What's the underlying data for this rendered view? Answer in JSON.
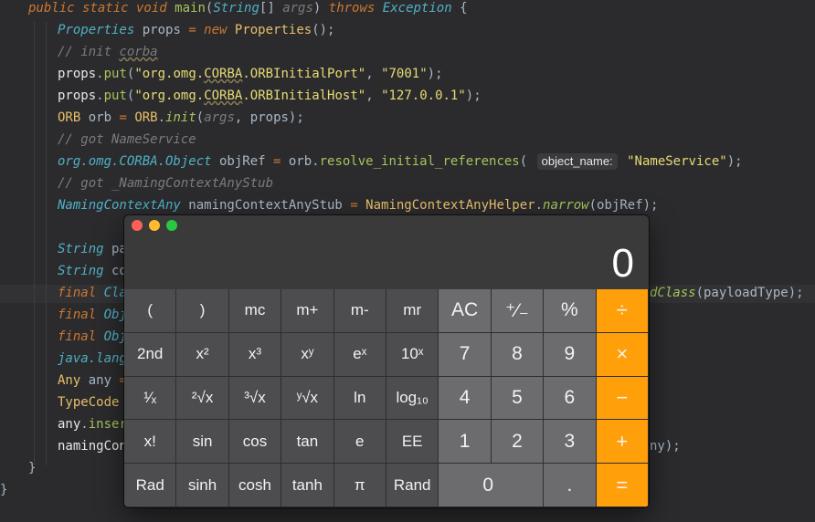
{
  "code": {
    "lines": [
      {
        "tokens": [
          [
            "kw",
            "public static void "
          ],
          [
            "fn",
            "main"
          ],
          [
            "p",
            "("
          ],
          [
            "type",
            "String"
          ],
          [
            "p",
            "[] "
          ],
          [
            "cm",
            "args"
          ],
          [
            "p",
            ") "
          ],
          [
            "kw",
            "throws "
          ],
          [
            "type",
            "Exception"
          ],
          [
            "p",
            " {"
          ]
        ]
      },
      {
        "tokens": [
          [
            "type",
            "Properties"
          ],
          [
            "p",
            " props "
          ],
          [
            "kw",
            "= new "
          ],
          [
            "typ2",
            "Properties"
          ],
          [
            "p",
            "();"
          ]
        ]
      },
      {
        "tokens": [
          [
            "cm",
            "// init "
          ],
          [
            "cmsq",
            "corba"
          ]
        ]
      },
      {
        "tokens": [
          [
            "var",
            "props"
          ],
          [
            "p",
            "."
          ],
          [
            "fn",
            "put"
          ],
          [
            "p",
            "("
          ],
          [
            "str",
            "\"org.omg."
          ],
          [
            "strsq",
            "CORBA"
          ],
          [
            "str",
            ".ORBInitialPort\""
          ],
          [
            "p",
            ", "
          ],
          [
            "str",
            "\"7001\""
          ],
          [
            "p",
            ");"
          ]
        ]
      },
      {
        "tokens": [
          [
            "var",
            "props"
          ],
          [
            "p",
            "."
          ],
          [
            "fn",
            "put"
          ],
          [
            "p",
            "("
          ],
          [
            "str",
            "\"org.omg."
          ],
          [
            "strsq",
            "CORBA"
          ],
          [
            "str",
            ".ORBInitialHost\""
          ],
          [
            "p",
            ", "
          ],
          [
            "str",
            "\"127.0.0.1\""
          ],
          [
            "p",
            ");"
          ]
        ]
      },
      {
        "tokens": [
          [
            "typ2",
            "ORB"
          ],
          [
            "p",
            " orb "
          ],
          [
            "kw",
            "= "
          ],
          [
            "typ2",
            "ORB"
          ],
          [
            "p",
            "."
          ],
          [
            "fni",
            "init"
          ],
          [
            "p",
            "("
          ],
          [
            "cm",
            "args"
          ],
          [
            "p",
            ", props);"
          ]
        ]
      },
      {
        "tokens": [
          [
            "cm",
            "// got NameService"
          ]
        ]
      },
      {
        "tokens": [
          [
            "type",
            "org.omg.CORBA.Object"
          ],
          [
            "p",
            " objRef "
          ],
          [
            "kw",
            "= "
          ],
          [
            "p",
            "orb."
          ],
          [
            "fn",
            "resolve_initial_references"
          ],
          [
            "p",
            "( "
          ],
          [
            "hint",
            "object_name:"
          ],
          [
            "str",
            " \"NameService\""
          ],
          [
            "p",
            ");"
          ]
        ]
      },
      {
        "tokens": [
          [
            "cm",
            "// got _NamingContextAnyStub"
          ]
        ]
      },
      {
        "tokens": [
          [
            "type",
            "NamingContextAny"
          ],
          [
            "p",
            " namingContextAnyStub "
          ],
          [
            "kw",
            "= "
          ],
          [
            "typ2",
            "NamingContextAnyHelper"
          ],
          [
            "p",
            "."
          ],
          [
            "fni",
            "narrow"
          ],
          [
            "p",
            "(objRef);"
          ]
        ]
      },
      {
        "tokens": []
      },
      {
        "tokens": [
          [
            "type",
            "String"
          ],
          [
            "p",
            " pa"
          ]
        ]
      },
      {
        "tokens": [
          [
            "type",
            "String"
          ],
          [
            "p",
            " co"
          ]
        ]
      },
      {
        "tokens": [
          [
            "kw",
            "final "
          ],
          [
            "type",
            "Cla"
          ]
        ]
      },
      {
        "tokens": [
          [
            "kw",
            "final "
          ],
          [
            "type",
            "Obj"
          ]
        ]
      },
      {
        "tokens": [
          [
            "kw",
            "final "
          ],
          [
            "type",
            "Obj"
          ]
        ]
      },
      {
        "tokens": [
          [
            "type",
            "java.lang"
          ]
        ]
      },
      {
        "tokens": [
          [
            "typ2",
            "Any"
          ],
          [
            "p",
            " any "
          ],
          [
            "kw",
            "="
          ]
        ]
      },
      {
        "tokens": [
          [
            "typ2",
            "TypeCode"
          ]
        ]
      },
      {
        "tokens": [
          [
            "var",
            "any"
          ],
          [
            "p",
            "."
          ],
          [
            "fn",
            "inser"
          ]
        ]
      },
      {
        "tokens": [
          [
            "var",
            "namingCon"
          ]
        ]
      },
      {
        "tokens": [
          [
            "p",
            "}"
          ]
        ]
      },
      {
        "tokens": [
          [
            "p",
            "}"
          ]
        ]
      }
    ],
    "right_fragments": [
      {
        "line": 13,
        "tokens": [
          [
            "fni",
            "dClass"
          ],
          [
            "p",
            "(payloadType);"
          ]
        ]
      },
      {
        "line": 20,
        "tokens": [
          [
            "p",
            "ny);"
          ]
        ]
      }
    ]
  },
  "calculator": {
    "display_value": "0",
    "rows": [
      [
        {
          "label": "(",
          "name": "open-paren-key",
          "kind": "dark"
        },
        {
          "label": ")",
          "name": "close-paren-key",
          "kind": "dark"
        },
        {
          "label": "mc",
          "name": "memory-clear-key",
          "kind": "dark"
        },
        {
          "label": "m+",
          "name": "memory-add-key",
          "kind": "dark"
        },
        {
          "label": "m-",
          "name": "memory-subtract-key",
          "kind": "dark"
        },
        {
          "label": "mr",
          "name": "memory-recall-key",
          "kind": "dark"
        },
        {
          "label": "AC",
          "name": "all-clear-key",
          "kind": "num"
        },
        {
          "label": "⁺∕₋",
          "name": "plus-minus-key",
          "kind": "num"
        },
        {
          "label": "%",
          "name": "percent-key",
          "kind": "num"
        },
        {
          "label": "÷",
          "name": "divide-key",
          "kind": "op"
        }
      ],
      [
        {
          "label": "2nd",
          "name": "second-function-key",
          "kind": "dark"
        },
        {
          "label": "x²",
          "name": "square-key",
          "kind": "dark"
        },
        {
          "label": "x³",
          "name": "cube-key",
          "kind": "dark"
        },
        {
          "label": "xʸ",
          "name": "power-key",
          "kind": "dark"
        },
        {
          "label": "eˣ",
          "name": "exp-key",
          "kind": "dark"
        },
        {
          "label": "10ˣ",
          "name": "ten-power-key",
          "kind": "dark"
        },
        {
          "label": "7",
          "name": "digit-7-key",
          "kind": "num"
        },
        {
          "label": "8",
          "name": "digit-8-key",
          "kind": "num"
        },
        {
          "label": "9",
          "name": "digit-9-key",
          "kind": "num"
        },
        {
          "label": "×",
          "name": "multiply-key",
          "kind": "op"
        }
      ],
      [
        {
          "label": "¹⁄ₓ",
          "name": "reciprocal-key",
          "kind": "dark"
        },
        {
          "label": "²√x",
          "name": "square-root-key",
          "kind": "dark"
        },
        {
          "label": "³√x",
          "name": "cube-root-key",
          "kind": "dark"
        },
        {
          "label": "ʸ√x",
          "name": "nth-root-key",
          "kind": "dark"
        },
        {
          "label": "ln",
          "name": "ln-key",
          "kind": "dark"
        },
        {
          "label": "log₁₀",
          "name": "log10-key",
          "kind": "dark"
        },
        {
          "label": "4",
          "name": "digit-4-key",
          "kind": "num"
        },
        {
          "label": "5",
          "name": "digit-5-key",
          "kind": "num"
        },
        {
          "label": "6",
          "name": "digit-6-key",
          "kind": "num"
        },
        {
          "label": "−",
          "name": "subtract-key",
          "kind": "op"
        }
      ],
      [
        {
          "label": "x!",
          "name": "factorial-key",
          "kind": "dark"
        },
        {
          "label": "sin",
          "name": "sin-key",
          "kind": "dark"
        },
        {
          "label": "cos",
          "name": "cos-key",
          "kind": "dark"
        },
        {
          "label": "tan",
          "name": "tan-key",
          "kind": "dark"
        },
        {
          "label": "e",
          "name": "euler-key",
          "kind": "dark"
        },
        {
          "label": "EE",
          "name": "ee-key",
          "kind": "dark"
        },
        {
          "label": "1",
          "name": "digit-1-key",
          "kind": "num"
        },
        {
          "label": "2",
          "name": "digit-2-key",
          "kind": "num"
        },
        {
          "label": "3",
          "name": "digit-3-key",
          "kind": "num"
        },
        {
          "label": "+",
          "name": "add-key",
          "kind": "op"
        }
      ],
      [
        {
          "label": "Rad",
          "name": "rad-key",
          "kind": "dark"
        },
        {
          "label": "sinh",
          "name": "sinh-key",
          "kind": "dark"
        },
        {
          "label": "cosh",
          "name": "cosh-key",
          "kind": "dark"
        },
        {
          "label": "tanh",
          "name": "tanh-key",
          "kind": "dark"
        },
        {
          "label": "π",
          "name": "pi-key",
          "kind": "dark"
        },
        {
          "label": "Rand",
          "name": "rand-key",
          "kind": "dark"
        },
        {
          "label": "0",
          "name": "digit-0-key",
          "kind": "num",
          "span": 2
        },
        {
          "label": ".",
          "name": "decimal-key",
          "kind": "num"
        },
        {
          "label": "=",
          "name": "equals-key",
          "kind": "op"
        }
      ]
    ]
  }
}
